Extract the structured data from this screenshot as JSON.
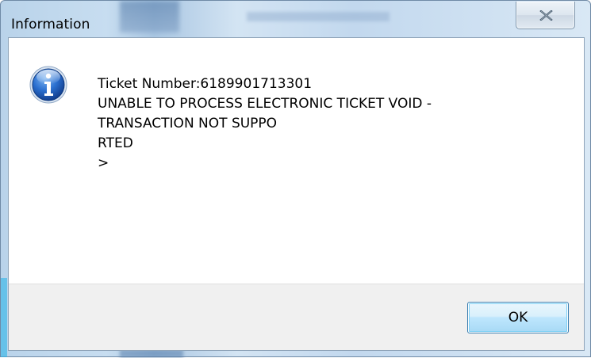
{
  "window": {
    "title": "Information",
    "close_icon": "close-x-icon"
  },
  "message": {
    "icon": "information-icon",
    "lines": [
      "Ticket Number:6189901713301",
      "UNABLE TO PROCESS ELECTRONIC TICKET VOID -",
      "TRANSACTION NOT SUPPO",
      "RTED",
      ">"
    ]
  },
  "buttons": {
    "ok_label": "OK"
  },
  "colors": {
    "accent": "#3c7fb1",
    "icon_blue": "#1e63c5"
  }
}
